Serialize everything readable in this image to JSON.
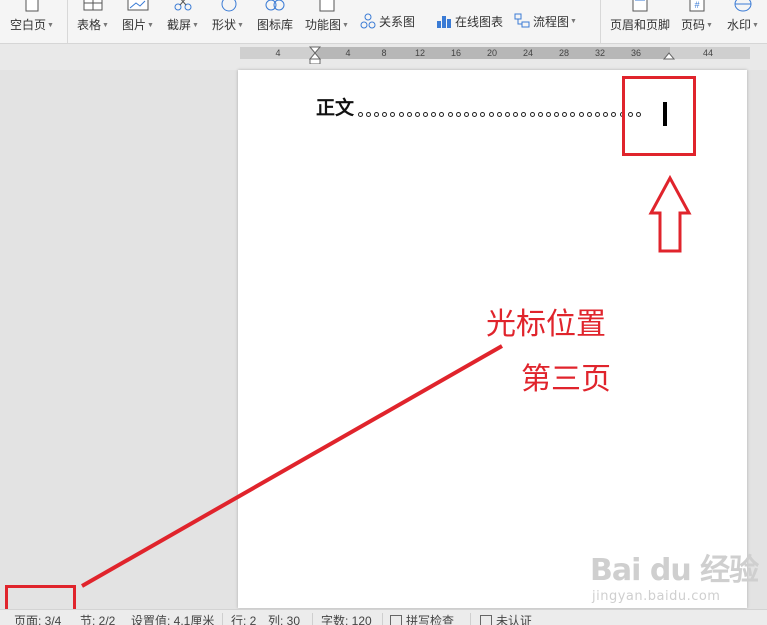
{
  "ribbon": {
    "blank_page": "空白页",
    "table": "表格",
    "picture": "图片",
    "screenshot": "截屏",
    "shape": "形状",
    "icon_library": "图标库",
    "function_chart": "功能图",
    "relation_chart": "关系图",
    "online_chart": "在线图表",
    "flowchart": "流程图",
    "header_footer": "页眉和页脚",
    "page_number": "页码",
    "watermark": "水印"
  },
  "ruler": {
    "ticks": [
      "4",
      "4",
      "8",
      "12",
      "16",
      "20",
      "24",
      "28",
      "32",
      "36",
      "44"
    ]
  },
  "document": {
    "toc_entry_text": "正文",
    "leader_dot_count": 35
  },
  "annotation": {
    "cursor_position": "光标位置",
    "third_page": "第三页",
    "color": "#e0242c"
  },
  "statusbar": {
    "page": "页面: 3/4",
    "section": "节: 2/2",
    "setting_value": "设置值: 4.1厘米",
    "row": "行: 2",
    "column": "列: 30",
    "word_count": "字数: 120",
    "spell_check": "拼写检查",
    "unverified": "未认证"
  },
  "watermark": {
    "logo": "Bai du 经验",
    "url": "jingyan.baidu.com"
  }
}
